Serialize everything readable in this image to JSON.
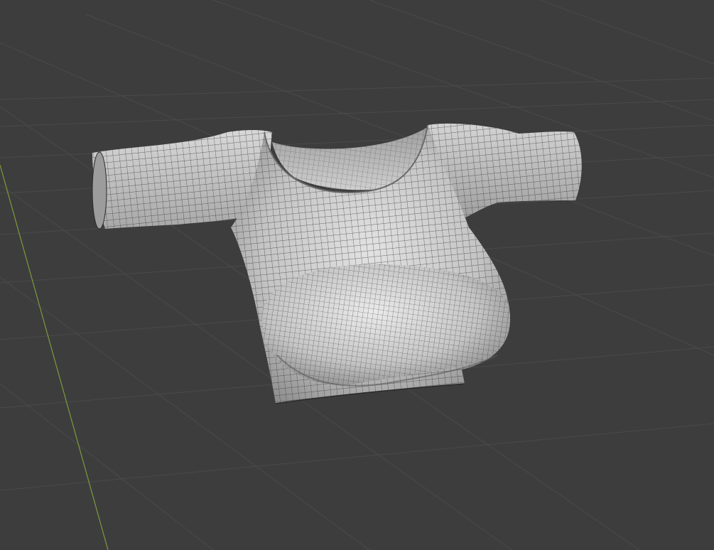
{
  "viewport": {
    "background_color": "#3d3d3d",
    "grid_line_color": "#4a4a4a",
    "y_axis_color": "#7c9a3c",
    "mesh": {
      "object_type": "garment-mesh",
      "shading": "solid",
      "overlay": "wireframe",
      "surface_color": "#c8c8c8",
      "wire_color": "#2a2a2a"
    }
  }
}
